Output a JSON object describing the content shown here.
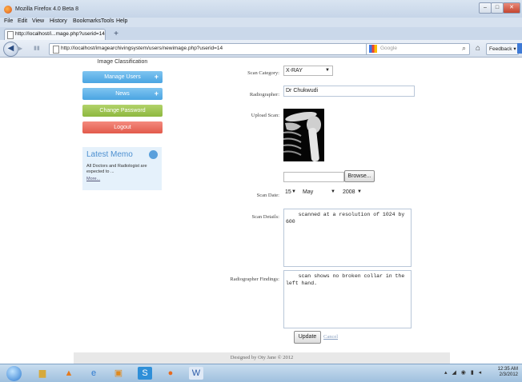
{
  "browser": {
    "window_title": "Mozilla Firefox 4.0 Beta 8",
    "menu": [
      "File",
      "Edit",
      "View",
      "History",
      "Bookmarks",
      "Tools",
      "Help"
    ],
    "tab_title": "http://localhost/i...mage.php?userid=14",
    "url": "http://localhost/imagearchivingsystem/users/newimage.php?userid=14",
    "search_placeholder": "Google",
    "feedback_label": "Feedback"
  },
  "sidebar": {
    "title": "Image Classification",
    "buttons": [
      {
        "label": "Manage Users",
        "has_plus": true
      },
      {
        "label": "News",
        "has_plus": true
      },
      {
        "label": "Change Password",
        "has_plus": false
      },
      {
        "label": "Logout",
        "has_plus": false
      }
    ],
    "memo": {
      "title": "Latest Memo",
      "text": "All Doctors and Radiologist are expected to ...",
      "more": "More..."
    }
  },
  "form": {
    "scan_category": {
      "label": "Scan Category:",
      "value": "X-RAY"
    },
    "radiographer": {
      "label": "Radiographer:",
      "value": "Dr Chukwudi"
    },
    "upload_scan": {
      "label": "Upload Scan:"
    },
    "browse_label": "Browse...",
    "scan_date": {
      "label": "Scan Date:",
      "day": "15",
      "month": "May",
      "year": "2008"
    },
    "scan_details": {
      "label": "Scan Details:",
      "value": "    scanned at a resolution of 1024 by 600"
    },
    "findings": {
      "label": "Radiographer Findings:",
      "value": "    scan shows no broken collar in the left hand."
    },
    "update_label": "Update",
    "cancel_label": "Cancel"
  },
  "footer": {
    "text": "Designed by Oty Jane © 2012"
  },
  "taskbar": {
    "time": "12:35 AM",
    "date": "2/3/2012"
  },
  "colors": {
    "blue_button": "#4aa5e2",
    "green_button": "#8db73f",
    "red_button": "#e25a4b",
    "memo_bg": "#e5f1fb"
  }
}
